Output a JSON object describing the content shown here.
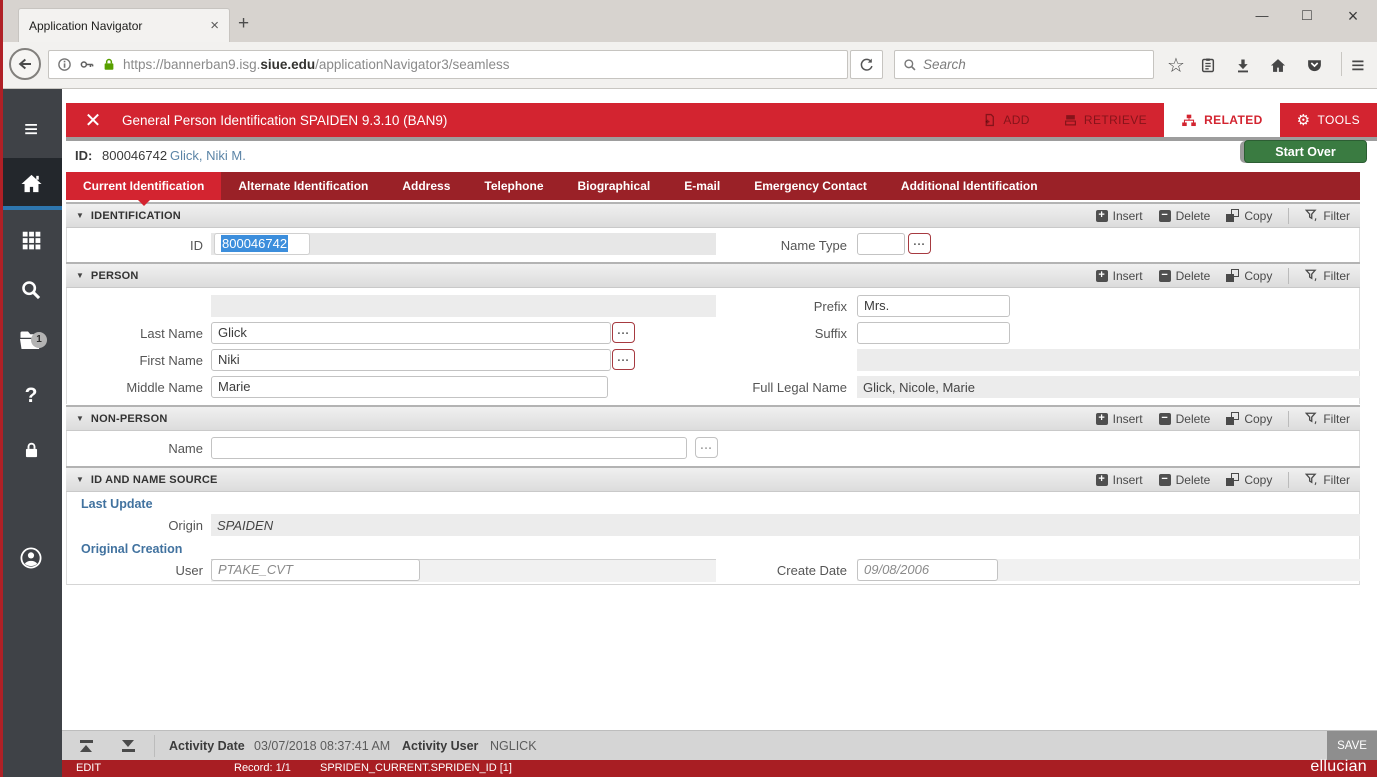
{
  "browser": {
    "tab_title": "Application Navigator",
    "url_scheme": "https://bannerban9.isg.",
    "url_domain": "siue.edu",
    "url_path": "/applicationNavigator3/seamless",
    "search_placeholder": "Search"
  },
  "icons": {
    "tab_close": "×",
    "new_tab": "+",
    "win_minimize": "—",
    "win_maximize": "□",
    "win_close": "×",
    "star": "☆",
    "menu": "≡",
    "form_close": "✕",
    "gear": "⚙",
    "caret_down": "▼",
    "plus": "+",
    "minus": "−",
    "ellipsis": "...",
    "help": "?"
  },
  "app_header": {
    "title": "General Person Identification SPAIDEN 9.3.10 (BAN9)",
    "add_label": "ADD",
    "retrieve_label": "RETRIEVE",
    "related_label": "RELATED",
    "tools_label": "TOOLS"
  },
  "key_block": {
    "id_label": "ID:",
    "id_value": "800046742",
    "person_name": "Glick, Niki M.",
    "start_over_label": "Start Over"
  },
  "tabs": [
    "Current Identification",
    "Alternate Identification",
    "Address",
    "Telephone",
    "Biographical",
    "E-mail",
    "Emergency Contact",
    "Additional Identification"
  ],
  "section_actions": {
    "insert": "Insert",
    "delete": "Delete",
    "copy": "Copy",
    "filter": "Filter"
  },
  "sections": {
    "identification": {
      "title": "IDENTIFICATION",
      "id_label": "ID",
      "id_value": "800046742",
      "name_type_label": "Name Type",
      "name_type_value": ""
    },
    "person": {
      "title": "PERSON",
      "last_name_label": "Last Name",
      "last_name": "Glick",
      "first_name_label": "First Name",
      "first_name": "Niki",
      "middle_name_label": "Middle Name",
      "middle_name": "Marie",
      "prefix_label": "Prefix",
      "prefix": "Mrs.",
      "suffix_label": "Suffix",
      "suffix": "",
      "full_legal_name_label": "Full Legal Name",
      "full_legal_name": "Glick, Nicole, Marie"
    },
    "non_person": {
      "title": "NON-PERSON",
      "name_label": "Name",
      "name": ""
    },
    "id_name_source": {
      "title": "ID AND NAME SOURCE",
      "last_update_label": "Last Update",
      "origin_label": "Origin",
      "origin": "SPAIDEN",
      "original_creation_label": "Original Creation",
      "user_label": "User",
      "user": "PTAKE_CVT",
      "create_date_label": "Create Date",
      "create_date": "09/08/2006"
    }
  },
  "footer": {
    "activity_date_label": "Activity Date",
    "activity_date": "03/07/2018 08:37:41 AM",
    "activity_user_label": "Activity User",
    "activity_user": "NGLICK",
    "save_label": "SAVE"
  },
  "status_bar": {
    "mode": "EDIT",
    "record": "Record: 1/1",
    "field": "SPRIDEN_CURRENT.SPRIDEN_ID [1]",
    "brand": "ellucian"
  },
  "sidebar": {
    "recent_badge": "1"
  },
  "colors": {
    "banner_red": "#d32430",
    "tab_bar_red": "#9a2127",
    "status_bar_red": "#a81e23",
    "start_over_green": "#3a7b41",
    "selection_blue": "#3c8edc",
    "name_link_blue": "#5b84a6",
    "https_lock_green": "#58a000",
    "sidebar_gray": "#3f4247"
  }
}
